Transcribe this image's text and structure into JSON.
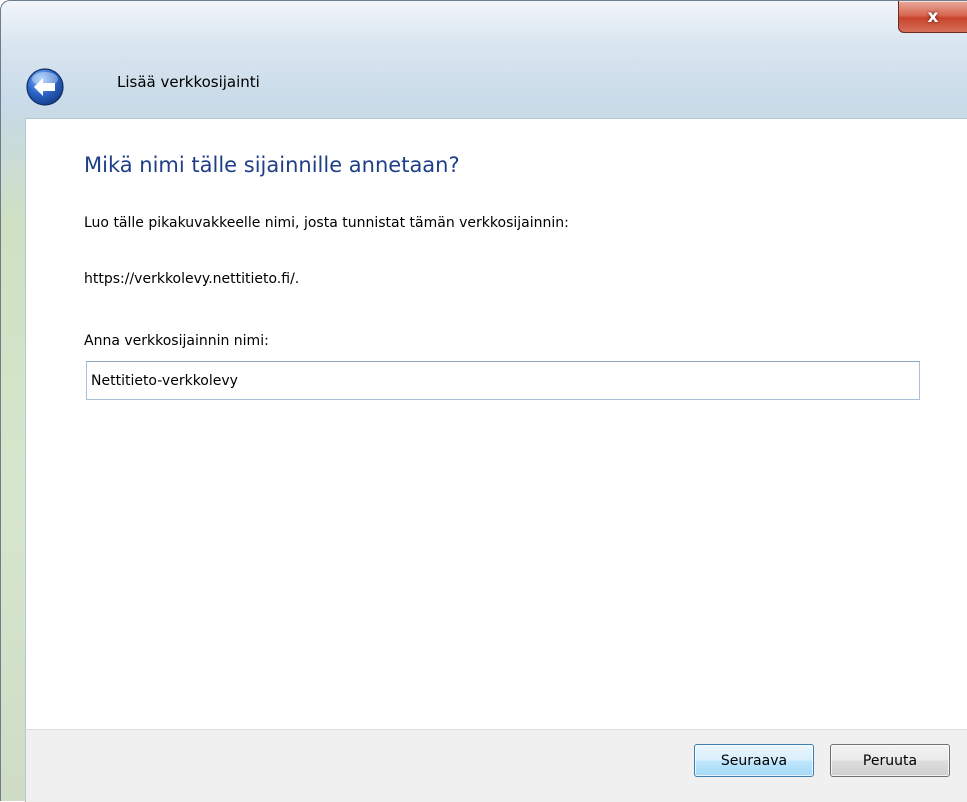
{
  "window": {
    "close_label": "x",
    "title": "Lisää verkkosijainti"
  },
  "main": {
    "heading": "Mikä nimi tälle sijainnille annetaan?",
    "description": "Luo tälle pikakuvakkeelle nimi, josta tunnistat tämän verkkosijainnin:",
    "url": "https://verkkolevy.nettitieto.fi/.",
    "name_label": "Anna verkkosijainnin nimi:",
    "name_value": "Nettitieto-verkkolevy"
  },
  "footer": {
    "next_label": "Seuraava",
    "cancel_label": "Peruuta"
  },
  "icons": {
    "back": "back-arrow-icon",
    "close": "close-icon"
  },
  "colors": {
    "heading": "#1e3f87",
    "close_button": "#c7432c",
    "back_button": "#2a63c4"
  }
}
